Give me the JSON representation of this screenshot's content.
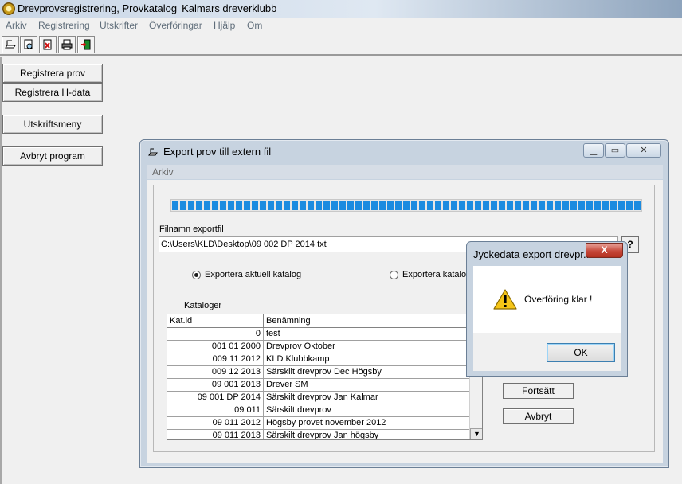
{
  "window": {
    "title_app": "Drevprovsregistrering, Provkatalog",
    "title_club": "Kalmars dreverklubb"
  },
  "menu": [
    "Arkiv",
    "Registrering",
    "Utskrifter",
    "Överföringar",
    "Hjälp",
    "Om"
  ],
  "toolbar": {
    "icons": [
      "new-document-icon",
      "print-preview-icon",
      "delete-document-icon",
      "printer-icon",
      "exit-door-icon"
    ]
  },
  "sidebar": {
    "register_test": "Registrera prov",
    "register_hdata": "Registrera H-data",
    "print_menu": "Utskriftsmeny",
    "cancel_program": "Avbryt program"
  },
  "export_dialog": {
    "title": "Export prov till extern fil",
    "menu": "Arkiv",
    "progress_fraction": 1.0,
    "filename_label": "Filnamn exportfil",
    "filename_value": "C:\\Users\\KLD\\Desktop\\09 002 DP 2014.txt",
    "help_button": "?",
    "radio_current": "Exportera aktuell katalog",
    "radio_other": "Exportera katalog",
    "catalogs_label": "Kataloger",
    "columns": [
      "Kat.id",
      "Benämning"
    ],
    "rows": [
      {
        "id": "0",
        "name": "test"
      },
      {
        "id": "001 01 2000",
        "name": "Drevprov Oktober"
      },
      {
        "id": "009 11 2012",
        "name": "KLD Klubbkamp"
      },
      {
        "id": "009 12 2013",
        "name": "Särskilt drevprov Dec Högsby"
      },
      {
        "id": "09 001 2013",
        "name": "Drever SM"
      },
      {
        "id": "09 001 DP 2014",
        "name": "Särskilt drevprov Jan Kalmar"
      },
      {
        "id": "09 011",
        "name": "Särskilt drevprov"
      },
      {
        "id": "09 011 2012",
        "name": "Högsby provet november 2012"
      },
      {
        "id": "09 011 2013",
        "name": "Särskilt drevprov Jan högsby"
      }
    ],
    "continue_button": "Fortsätt",
    "cancel_button": "Avbryt"
  },
  "message_box": {
    "title": "Jyckedata export drevpr...",
    "close": "X",
    "message": "Överföring klar !",
    "ok": "OK",
    "icon": "warning-icon"
  },
  "colors": {
    "progress": "#1b8be0",
    "close_button": "#c6483a"
  }
}
